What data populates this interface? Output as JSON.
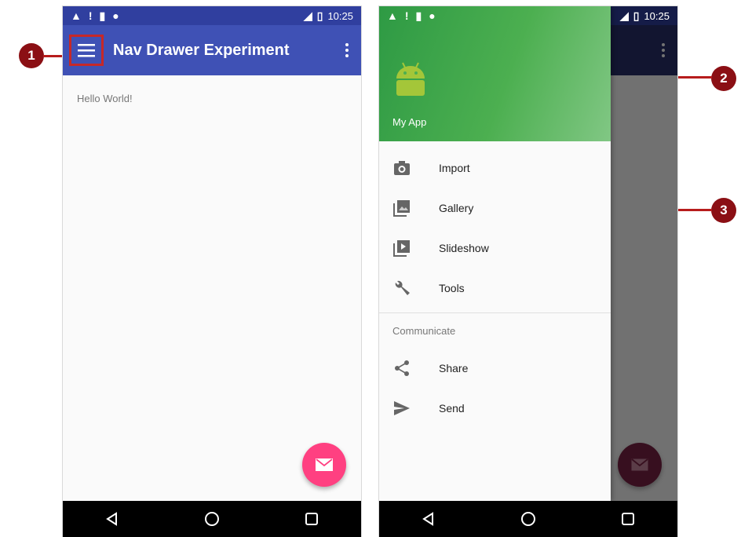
{
  "status_bar": {
    "time": "10:25"
  },
  "left_phone": {
    "toolbar_title": "Nav Drawer Experiment",
    "content_text": "Hello World!"
  },
  "drawer": {
    "app_name": "My App",
    "items": [
      {
        "label": "Import",
        "icon": "camera-icon"
      },
      {
        "label": "Gallery",
        "icon": "gallery-icon"
      },
      {
        "label": "Slideshow",
        "icon": "slideshow-icon"
      },
      {
        "label": "Tools",
        "icon": "wrench-icon"
      }
    ],
    "section_title": "Communicate",
    "section_items": [
      {
        "label": "Share",
        "icon": "share-icon"
      },
      {
        "label": "Send",
        "icon": "send-icon"
      }
    ]
  },
  "callouts": [
    "1",
    "2",
    "3"
  ],
  "colors": {
    "primary": "#3f51b5",
    "status_bar": "#303f9f",
    "accent": "#ff4081",
    "drawer_header": "#4caf50",
    "callout": "#8b0f14"
  }
}
